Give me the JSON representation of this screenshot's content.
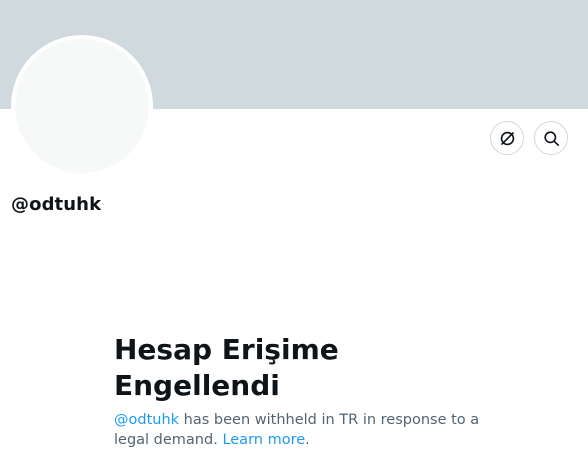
{
  "profile": {
    "handle": "@odtuhk"
  },
  "actions": {
    "unfollow_icon": "block-circle-icon",
    "search_icon": "search-icon"
  },
  "withheld": {
    "title": "Hesap Erişime Engellendi",
    "handle_link": "@odtuhk",
    "message": " has been withheld in TR in response to a legal demand. ",
    "learn_more": "Learn more",
    "end_period": "."
  },
  "colors": {
    "banner": "#cfd9de",
    "link": "#1d9bf0",
    "text_primary": "#0f1419",
    "text_secondary": "#536471"
  }
}
